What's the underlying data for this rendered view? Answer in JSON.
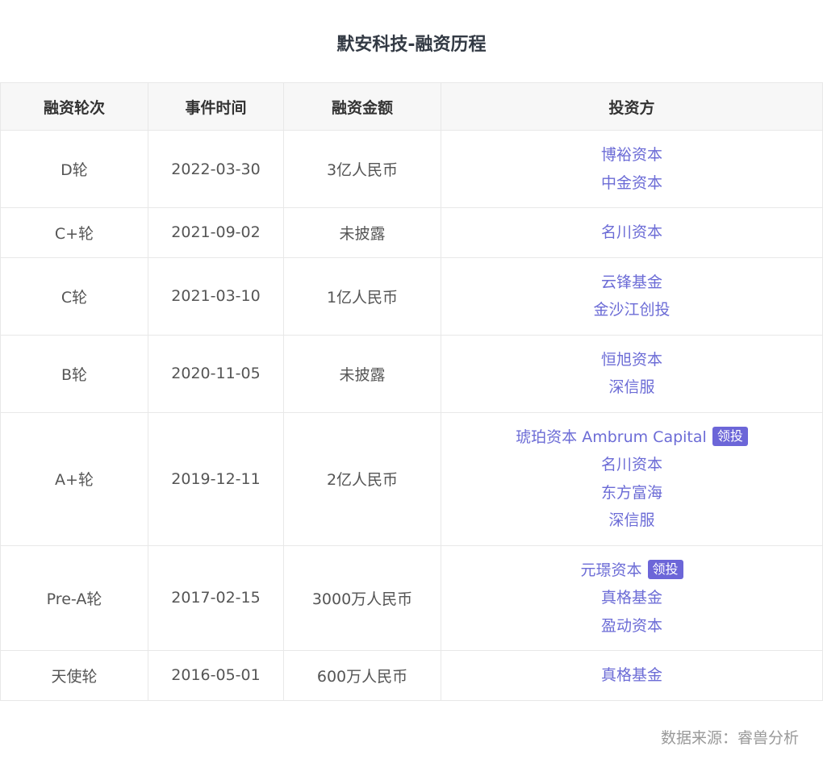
{
  "title": "默安科技-融资历程",
  "table": {
    "headers": [
      "融资轮次",
      "事件时间",
      "融资金额",
      "投资方"
    ],
    "rows": [
      {
        "round": "D轮",
        "date": "2022-03-30",
        "amount": "3亿人民币",
        "investors": [
          {
            "name": "博裕资本",
            "lead": ""
          },
          {
            "name": "中金资本",
            "lead": ""
          }
        ]
      },
      {
        "round": "C+轮",
        "date": "2021-09-02",
        "amount": "未披露",
        "investors": [
          {
            "name": "名川资本",
            "lead": ""
          }
        ]
      },
      {
        "round": "C轮",
        "date": "2021-03-10",
        "amount": "1亿人民币",
        "investors": [
          {
            "name": "云锋基金",
            "lead": ""
          },
          {
            "name": "金沙江创投",
            "lead": ""
          }
        ]
      },
      {
        "round": "B轮",
        "date": "2020-11-05",
        "amount": "未披露",
        "investors": [
          {
            "name": "恒旭资本",
            "lead": ""
          },
          {
            "name": "深信服",
            "lead": ""
          }
        ]
      },
      {
        "round": "A+轮",
        "date": "2019-12-11",
        "amount": "2亿人民币",
        "investors": [
          {
            "name": "琥珀资本 Ambrum Capital",
            "lead": "领投"
          },
          {
            "name": "名川资本",
            "lead": ""
          },
          {
            "name": "东方富海",
            "lead": ""
          },
          {
            "name": "深信服",
            "lead": ""
          }
        ]
      },
      {
        "round": "Pre-A轮",
        "date": "2017-02-15",
        "amount": "3000万人民币",
        "investors": [
          {
            "name": "元璟资本",
            "lead": "领投"
          },
          {
            "name": "真格基金",
            "lead": ""
          },
          {
            "name": "盈动资本",
            "lead": ""
          }
        ]
      },
      {
        "round": "天使轮",
        "date": "2016-05-01",
        "amount": "600万人民币",
        "investors": [
          {
            "name": "真格基金",
            "lead": ""
          }
        ]
      }
    ]
  },
  "source": "数据来源：睿兽分析",
  "colors": {
    "investor_link": "#6c6cd6",
    "lead_badge": "#6c66d8",
    "header_bg": "#f7f7f7",
    "border": "#e8e8e8"
  }
}
